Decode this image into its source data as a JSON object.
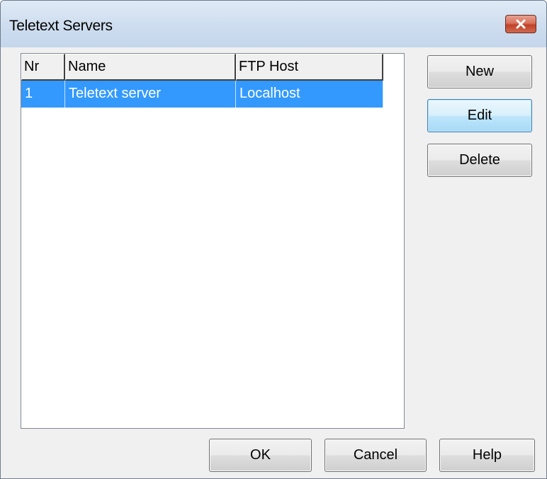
{
  "window": {
    "title": "Teletext Servers",
    "close_icon": "close-icon"
  },
  "list": {
    "columns": [
      "Nr",
      "Name",
      "FTP Host"
    ],
    "rows": [
      {
        "nr": "1",
        "name": "Teletext server",
        "ftp_host": "Localhost",
        "selected": true
      }
    ],
    "selection_color": "#3399ff"
  },
  "side_buttons": {
    "new": "New",
    "edit": "Edit",
    "delete": "Delete"
  },
  "footer_buttons": {
    "ok": "OK",
    "cancel": "Cancel",
    "help": "Help"
  }
}
